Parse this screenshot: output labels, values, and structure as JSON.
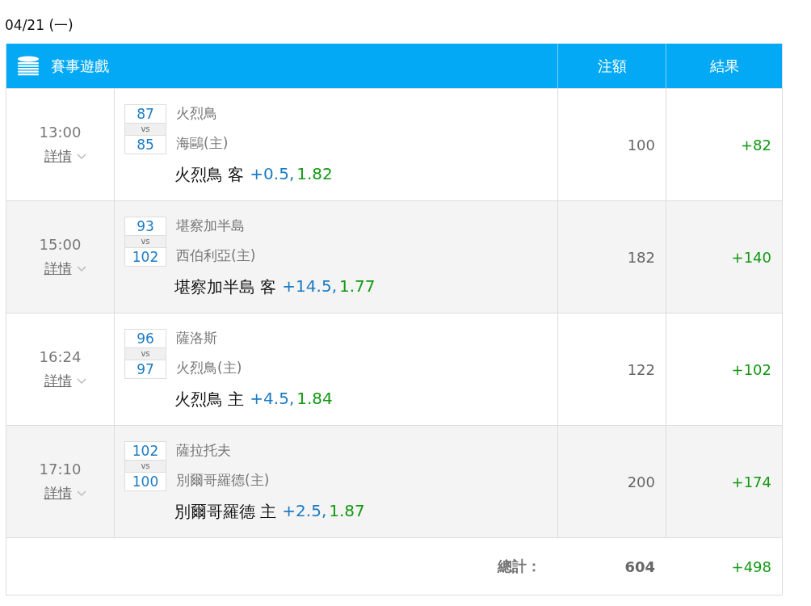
{
  "date": "04/21 (一)",
  "table": {
    "columns": [
      "賽事遊戲",
      "注額",
      "結果"
    ],
    "rows": [
      {
        "time": "13:00",
        "details": "詳情",
        "away_score": "87",
        "vs": "vs",
        "home_score": "85",
        "away_team": "火烈鳥",
        "home_team": "海鷗(主)",
        "pick": "火烈鳥 客",
        "line": "+0.5,",
        "odds": "1.82",
        "stake": "100",
        "result": "+82"
      },
      {
        "time": "15:00",
        "details": "詳情",
        "away_score": "93",
        "vs": "vs",
        "home_score": "102",
        "away_team": "堪察加半島",
        "home_team": "西伯利亞(主)",
        "pick": "堪察加半島 客",
        "line": "+14.5,",
        "odds": "1.77",
        "stake": "182",
        "result": "+140"
      },
      {
        "time": "16:24",
        "details": "詳情",
        "away_score": "96",
        "vs": "vs",
        "home_score": "97",
        "away_team": "薩洛斯",
        "home_team": "火烈鳥(主)",
        "pick": "火烈鳥 主",
        "line": "+4.5,",
        "odds": "1.84",
        "stake": "122",
        "result": "+102"
      },
      {
        "time": "17:10",
        "details": "詳情",
        "away_score": "102",
        "vs": "vs",
        "home_score": "100",
        "away_team": "薩拉托夫",
        "home_team": "別爾哥羅德(主)",
        "pick": "別爾哥羅德 主",
        "line": "+2.5,",
        "odds": "1.87",
        "stake": "200",
        "result": "+174"
      }
    ],
    "total": {
      "label": "總計：",
      "stake": "604",
      "result": "+498"
    }
  }
}
